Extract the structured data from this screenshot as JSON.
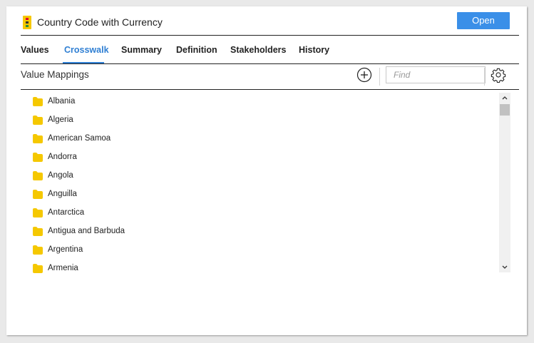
{
  "header": {
    "title": "Country Code with Currency",
    "app_icon": "stacked-blocks-icon",
    "open_label": "Open",
    "accent_color": "#3a8fe8"
  },
  "tabs": [
    {
      "label": "Values",
      "active": false
    },
    {
      "label": "Crosswalk",
      "active": true
    },
    {
      "label": "Summary",
      "active": false
    },
    {
      "label": "Definition",
      "active": false
    },
    {
      "label": "Stakeholders",
      "active": false
    },
    {
      "label": "History",
      "active": false
    }
  ],
  "value_mappings": {
    "title": "Value Mappings",
    "add_icon": "plus-circle-icon",
    "find_placeholder": "Find",
    "settings_icon": "gear-icon"
  },
  "items": [
    {
      "label": "Albania",
      "icon": "folder-icon"
    },
    {
      "label": "Algeria",
      "icon": "folder-icon"
    },
    {
      "label": "American Samoa",
      "icon": "folder-icon"
    },
    {
      "label": "Andorra",
      "icon": "folder-icon"
    },
    {
      "label": "Angola",
      "icon": "folder-icon"
    },
    {
      "label": "Anguilla",
      "icon": "folder-icon"
    },
    {
      "label": "Antarctica",
      "icon": "folder-icon"
    },
    {
      "label": "Antigua and Barbuda",
      "icon": "folder-icon"
    },
    {
      "label": "Argentina",
      "icon": "folder-icon"
    },
    {
      "label": "Armenia",
      "icon": "folder-icon"
    }
  ],
  "folder_color": "#f5c800"
}
